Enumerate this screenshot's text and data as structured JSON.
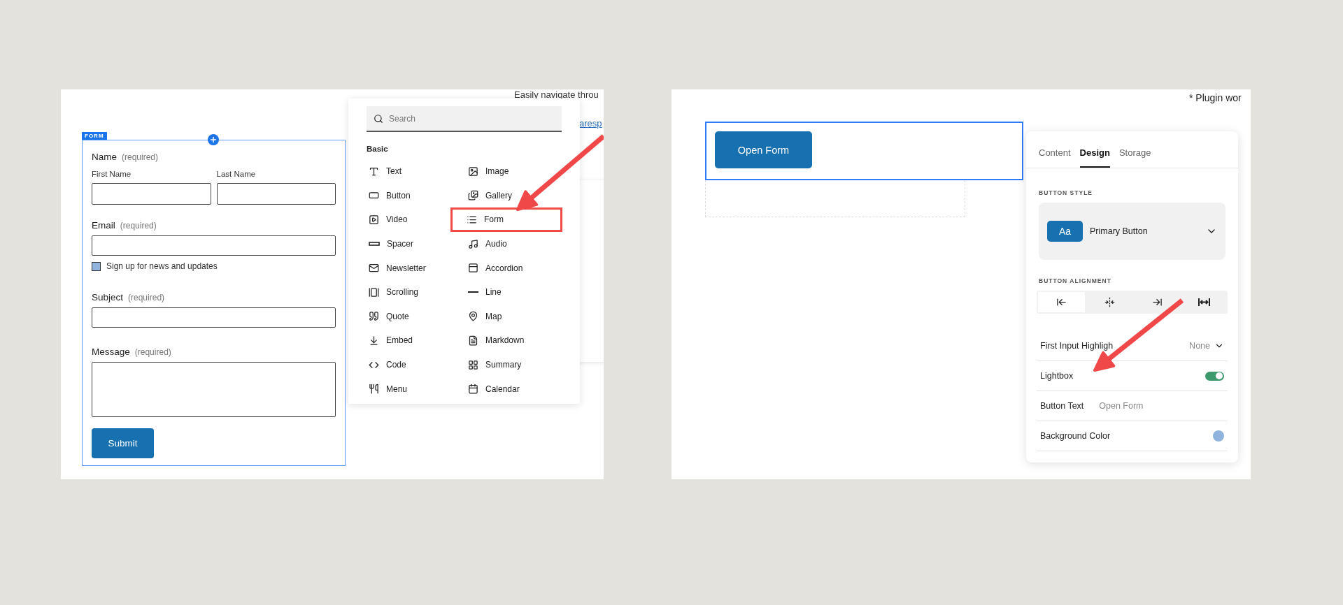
{
  "left_screen": {
    "background_texts": [
      {
        "kind": "text",
        "text": "Easily navigate throu"
      },
      {
        "kind": "link",
        "text": "aresp"
      }
    ],
    "form_block": {
      "tag": "FORM",
      "fields": [
        {
          "kind": "name",
          "label": "Name",
          "note": "(required)",
          "sublabels": [
            "First Name",
            "Last Name"
          ]
        },
        {
          "kind": "text",
          "label": "Email",
          "note": "(required)"
        },
        {
          "kind": "checkbox",
          "label": "Sign up for news and updates",
          "checked": false
        },
        {
          "kind": "text",
          "label": "Subject",
          "note": "(required)"
        },
        {
          "kind": "textarea",
          "label": "Message",
          "note": "(required)"
        }
      ],
      "submit": "Submit"
    },
    "block_picker": {
      "search_placeholder": "Search",
      "section": "Basic",
      "items": [
        {
          "label": "Text",
          "highlighted": false
        },
        {
          "label": "Image",
          "highlighted": false
        },
        {
          "label": "Button",
          "highlighted": false
        },
        {
          "label": "Gallery",
          "highlighted": false
        },
        {
          "label": "Video",
          "highlighted": false
        },
        {
          "label": "Form",
          "highlighted": true
        },
        {
          "label": "Spacer",
          "highlighted": false
        },
        {
          "label": "Audio",
          "highlighted": false
        },
        {
          "label": "Newsletter",
          "highlighted": false
        },
        {
          "label": "Accordion",
          "highlighted": false
        },
        {
          "label": "Scrolling",
          "highlighted": false
        },
        {
          "label": "Line",
          "highlighted": false
        },
        {
          "label": "Quote",
          "highlighted": false
        },
        {
          "label": "Map",
          "highlighted": false
        },
        {
          "label": "Embed",
          "highlighted": false
        },
        {
          "label": "Markdown",
          "highlighted": false
        },
        {
          "label": "Code",
          "highlighted": false
        },
        {
          "label": "Summary",
          "highlighted": false
        },
        {
          "label": "Menu",
          "highlighted": false
        },
        {
          "label": "Calendar",
          "highlighted": false
        }
      ]
    }
  },
  "right_screen": {
    "note": "* Plugin wor",
    "open_button": "Open Form",
    "settings_panel": {
      "tabs": [
        {
          "label": "Content",
          "selected": false
        },
        {
          "label": "Design",
          "selected": true
        },
        {
          "label": "Storage",
          "selected": false
        }
      ],
      "button_style": {
        "heading": "BUTTON STYLE",
        "badge": "Aa",
        "value": "Primary Button"
      },
      "button_alignment": {
        "heading": "BUTTON ALIGNMENT",
        "options": [
          {
            "selected": true
          },
          {
            "selected": false
          },
          {
            "selected": false
          },
          {
            "selected": false
          }
        ]
      },
      "rows": [
        {
          "kind": "select",
          "label": "First Input Highligh",
          "value": "None"
        },
        {
          "kind": "toggle",
          "label": "Lightbox",
          "on": true
        },
        {
          "kind": "text",
          "label": "Button Text",
          "value": "Open Form"
        },
        {
          "kind": "color",
          "label": "Background Color",
          "color": "#8fb3dd"
        }
      ]
    }
  }
}
